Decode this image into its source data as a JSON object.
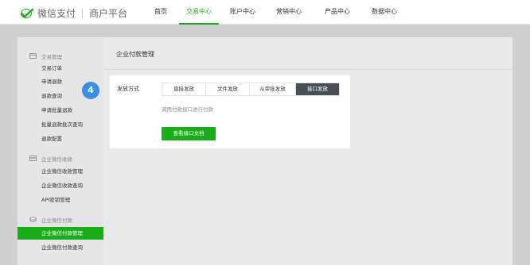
{
  "header": {
    "brand_name": "微信支付",
    "brand_sub": "商户平台",
    "nav": [
      {
        "label": "首页"
      },
      {
        "label": "交易中心"
      },
      {
        "label": "账户中心"
      },
      {
        "label": "营销中心"
      },
      {
        "label": "产品中心"
      },
      {
        "label": "数据中心"
      }
    ],
    "active_nav": "交易中心"
  },
  "sidebar": {
    "groups": [
      {
        "label": "交易管理",
        "icon": "trade-icon",
        "items": [
          "交易订单",
          "申请退款",
          "退款查询",
          "申请批量退款",
          "批量退款批次查询",
          "退款配置"
        ]
      },
      {
        "label": "企业微信收款",
        "icon": "card-icon",
        "items": [
          "企业微信收款管理",
          "企业微信收款查询",
          "API密钥管理"
        ]
      },
      {
        "label": "企业微信付款",
        "icon": "coin-icon",
        "items": [
          "企业微信付款管理",
          "企业微信付款查询"
        ]
      }
    ],
    "active_item": "企业微信付款管理"
  },
  "main": {
    "title": "企业付款管理",
    "field_label": "发放方式",
    "methods": [
      "直接发放",
      "文件发放",
      "从审批发放",
      "接口发放"
    ],
    "active_method": "接口发放",
    "hint": "调用付款接口进行付款",
    "doc_button": "查看接口文档"
  },
  "step_badge": "4",
  "colors": {
    "accent": "#1aad19",
    "active_segment": "#4a4f56",
    "badge": "#3c8fe3"
  }
}
